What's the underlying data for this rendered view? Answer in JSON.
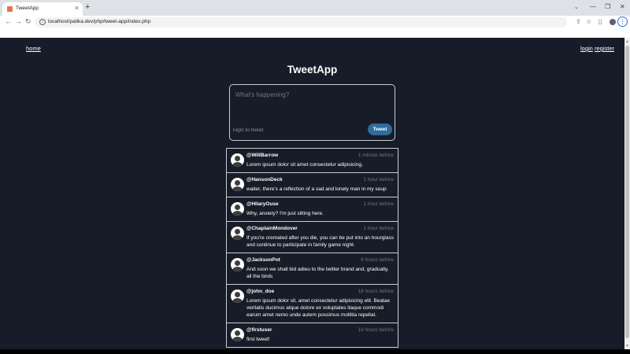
{
  "browser": {
    "tab_title": "TweetApp",
    "url": "localhost/patika.dev/php/tweet-app/index.php"
  },
  "nav": {
    "home": "home",
    "login": "login",
    "register": "register"
  },
  "app": {
    "title": "TweetApp"
  },
  "composer": {
    "placeholder": "What's happening?",
    "hint": "login to tweet",
    "button_label": "Tweet"
  },
  "tweets": [
    {
      "user": "@WillBarrow",
      "time": "1 minute before",
      "text": "Lorem ipsum dolor sit amet consectetur adipisicing."
    },
    {
      "user": "@HansonDeck",
      "time": "1 hour before",
      "text": "waiter, there's a reflection of a sad and lonely man in my soup"
    },
    {
      "user": "@HilaryOuse",
      "time": "1 hour before",
      "text": "Why, anxiety? I'm just sitting here."
    },
    {
      "user": "@ChaplainMondover",
      "time": "1 hour before",
      "text": "If you're cremated after you die, you can be put into an hourglass and continue to participate in family game night."
    },
    {
      "user": "@JacksonPot",
      "time": "6 hours before",
      "text": "And soon we shall bid adieu to the twitter brand and, gradually, all the birds"
    },
    {
      "user": "@john_doe",
      "time": "18 hours before",
      "text": "Lorem ipsum dolor sit, amet consectetur adipisicing elit. Beatae veritatis ducimus atque dolore ex voluptates itaque commodi earum amet nemo unde autem possimus mollitia repellat."
    },
    {
      "user": "@firstuser",
      "time": "19 hours before",
      "text": "first tweet!"
    }
  ]
}
